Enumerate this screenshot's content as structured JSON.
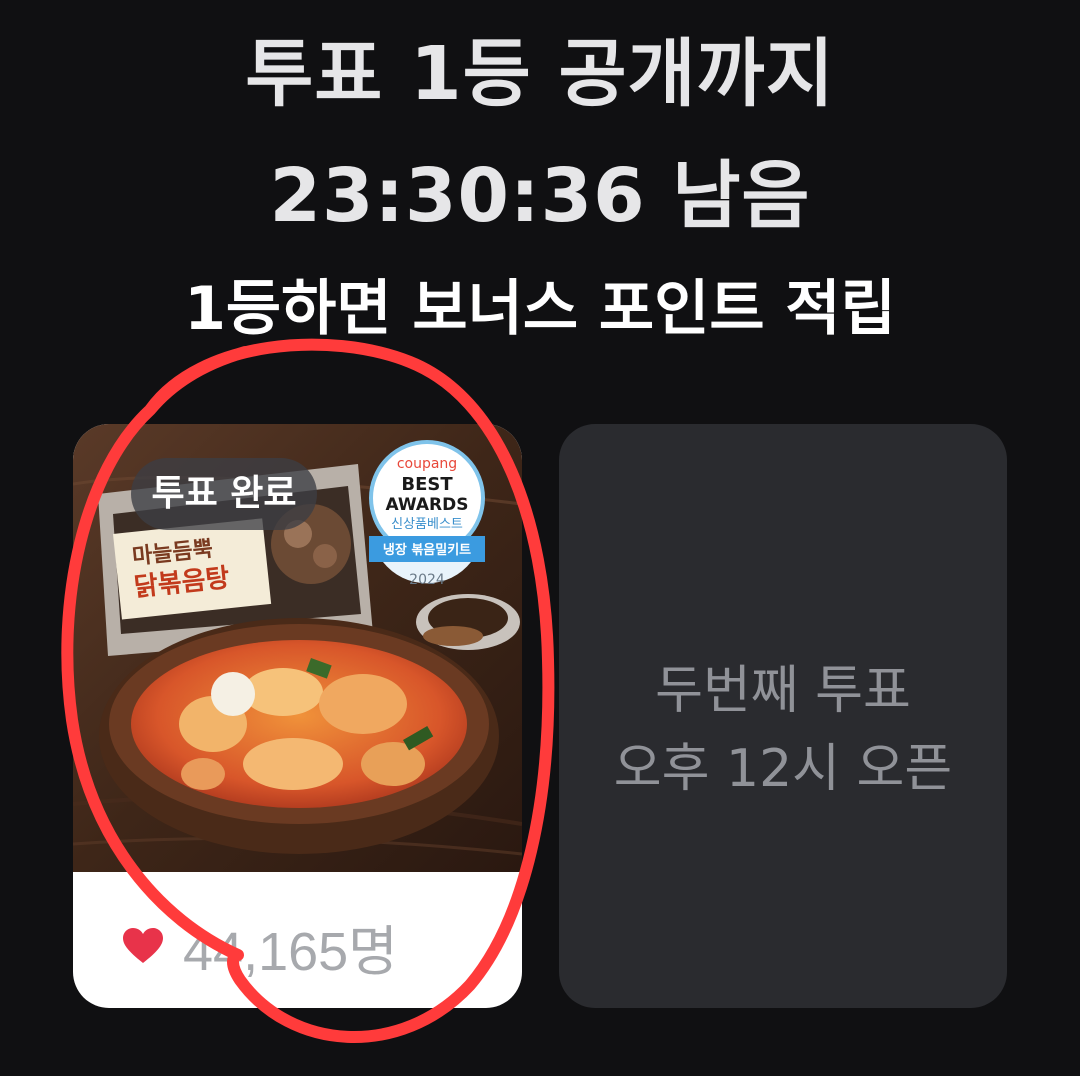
{
  "header": {
    "line1": "투표 1등 공개까지",
    "countdown": "23:30:36 남음",
    "line3": "1등하면 보너스 포인트 적립"
  },
  "voted_card": {
    "badge": "투표 완료",
    "package_brand": "마늘듬뿍",
    "package_title": "닭볶음탕",
    "award": {
      "brand": "coupang",
      "line1": "BEST",
      "line2": "AWARDS",
      "line3": "신상품베스트",
      "category": "냉장 볶음밀키트",
      "year": "2024"
    },
    "vote_count": "44,165명",
    "heart_icon": "heart-icon",
    "heart_color": "#e8334a"
  },
  "next_card": {
    "line1": "두번째 투표",
    "line2": "오후 12시 오픈"
  },
  "annotation_color": "#ff3b3b"
}
